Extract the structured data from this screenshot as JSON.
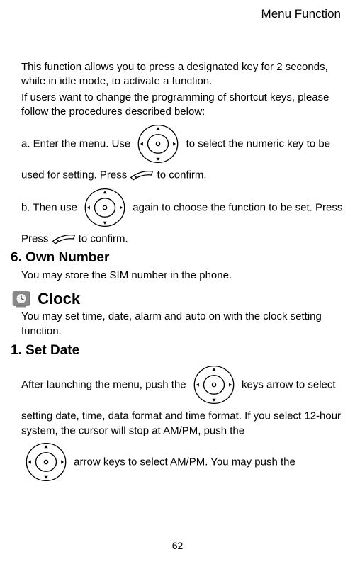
{
  "header": {
    "title": "Menu Function"
  },
  "intro": {
    "p1": "This function allows you to press a designated key for 2 seconds, while in idle mode, to activate a function.",
    "p2": "If users want to change the programming of shortcut keys, please follow the procedures described below:"
  },
  "stepA": {
    "s1": "a. Enter the menu. Use ",
    "s2": " to select the numeric key to be used for setting. Press ",
    "s3": " to confirm."
  },
  "stepB": {
    "s1": "b. Then use ",
    "s2": " again to choose the function to be set. Press ",
    "s3": " to confirm."
  },
  "ownNumber": {
    "heading": "6. Own Number",
    "body": "You may store the SIM number in the phone."
  },
  "clock": {
    "heading": "Clock",
    "body": "You may set time, date, alarm and auto on with the clock setting function."
  },
  "setDate": {
    "heading": "1. Set Date",
    "s1": "After launching the menu, push the ",
    "s2": " keys arrow to select setting date, time, data format and time format. If you select 12-hour system, the cursor will stop at AM/PM, push the ",
    "s3": " arrow keys to select AM/PM. You may push the"
  },
  "pageNumber": "62"
}
